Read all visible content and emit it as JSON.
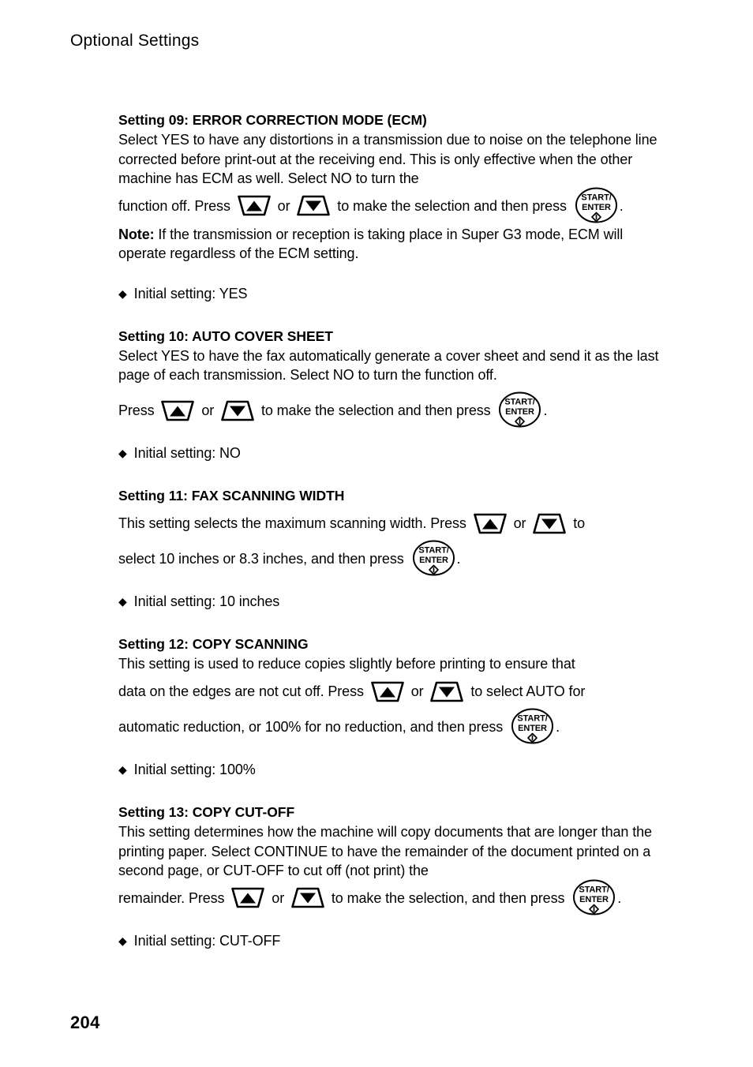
{
  "header": {
    "running_title": "Optional Settings"
  },
  "icons": {
    "up_arrow": "up-arrow-key-icon",
    "down_arrow": "down-arrow-key-icon",
    "start_enter": "start-enter-key-icon",
    "bullet": "diamond-bullet-icon"
  },
  "key_labels": {
    "start": "START/",
    "enter": "ENTER"
  },
  "sections": [
    {
      "heading": "Setting 09: ERROR CORRECTION MODE (ECM)",
      "body_part1": "Select YES to have any distortions in a transmission due to noise on the telephone line corrected before print-out at the receiving end. This is only effective when the other machine has ECM as well. Select NO to turn the",
      "key_line_pre": "function off. Press",
      "key_line_mid": "or",
      "key_line_post": "to make the selection and then press",
      "key_line_end": ".",
      "note_label": "Note:",
      "note_text": " If the transmission or reception is taking place in Super G3 mode, ECM will operate regardless of the ECM setting.",
      "initial_setting": "Initial setting: YES"
    },
    {
      "heading": "Setting 10: AUTO COVER SHEET",
      "body_part1": "Select YES to have the fax automatically generate a cover sheet and send it as the last page of each transmission. Select NO to turn the function off.",
      "key_line_pre": "Press",
      "key_line_mid": "or",
      "key_line_post": "to make the selection and then press",
      "key_line_end": ".",
      "initial_setting": "Initial setting: NO"
    },
    {
      "heading": "Setting 11: FAX SCANNING WIDTH",
      "key_line_pre": "This setting selects the maximum scanning width. Press",
      "key_line_mid": "or",
      "key_line_post": "to",
      "key_line2_pre": "select 10 inches or 8.3 inches, and then press",
      "key_line_end": ".",
      "initial_setting": "Initial setting: 10 inches"
    },
    {
      "heading": "Setting 12: COPY SCANNING",
      "body_part1": "This setting is used to reduce copies slightly before printing to ensure that",
      "key_line_pre": "data on the edges are not cut off. Press",
      "key_line_mid": "or",
      "key_line_post": "to select AUTO for",
      "key_line2_pre": "automatic reduction, or 100% for no reduction, and then press",
      "key_line_end": ".",
      "initial_setting": "Initial setting: 100%"
    },
    {
      "heading": "Setting 13: COPY CUT-OFF",
      "body_part1": "This setting determines how the machine will copy documents that are longer than the printing paper. Select CONTINUE to have the remainder of the document printed on a second page, or CUT-OFF to cut off (not print) the",
      "key_line_pre": "remainder. Press",
      "key_line_mid": "or",
      "key_line_post": "to make the selection, and then press",
      "key_line_end": ".",
      "initial_setting": "Initial setting: CUT-OFF"
    }
  ],
  "footer": {
    "page_number": "204"
  }
}
